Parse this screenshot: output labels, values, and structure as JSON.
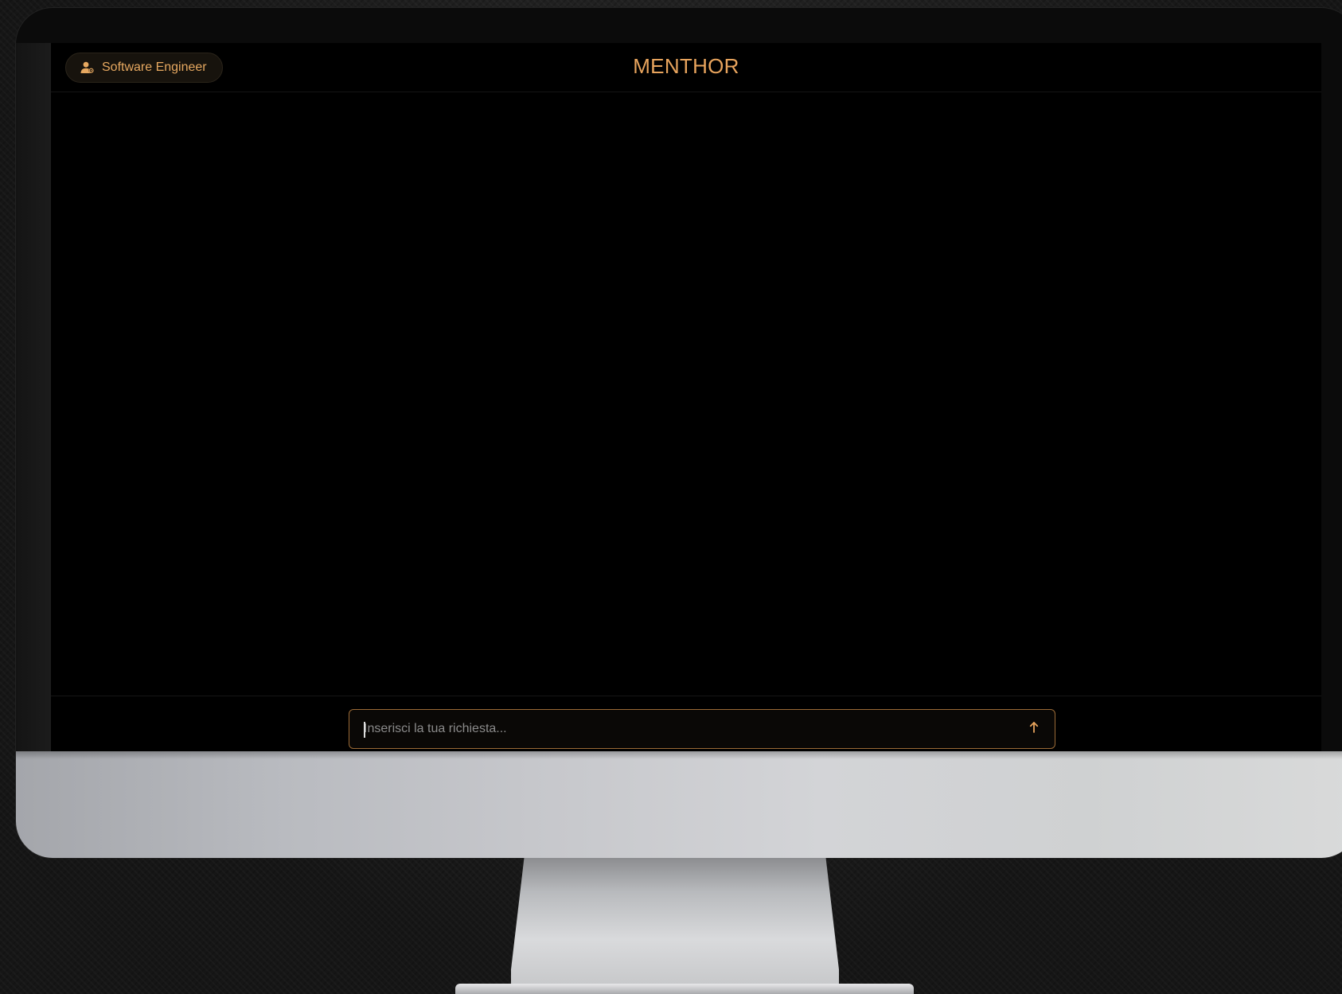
{
  "header": {
    "role_label": "Software Engineer",
    "title": "MENTHOR"
  },
  "composer": {
    "placeholder": "Inserisci la tua richiesta...",
    "value": ""
  },
  "icons": {
    "role": "user-icon",
    "send": "arrow-up-icon"
  },
  "colors": {
    "accent": "#e8a45d",
    "input_border": "#9a6a36",
    "background": "#000000"
  }
}
